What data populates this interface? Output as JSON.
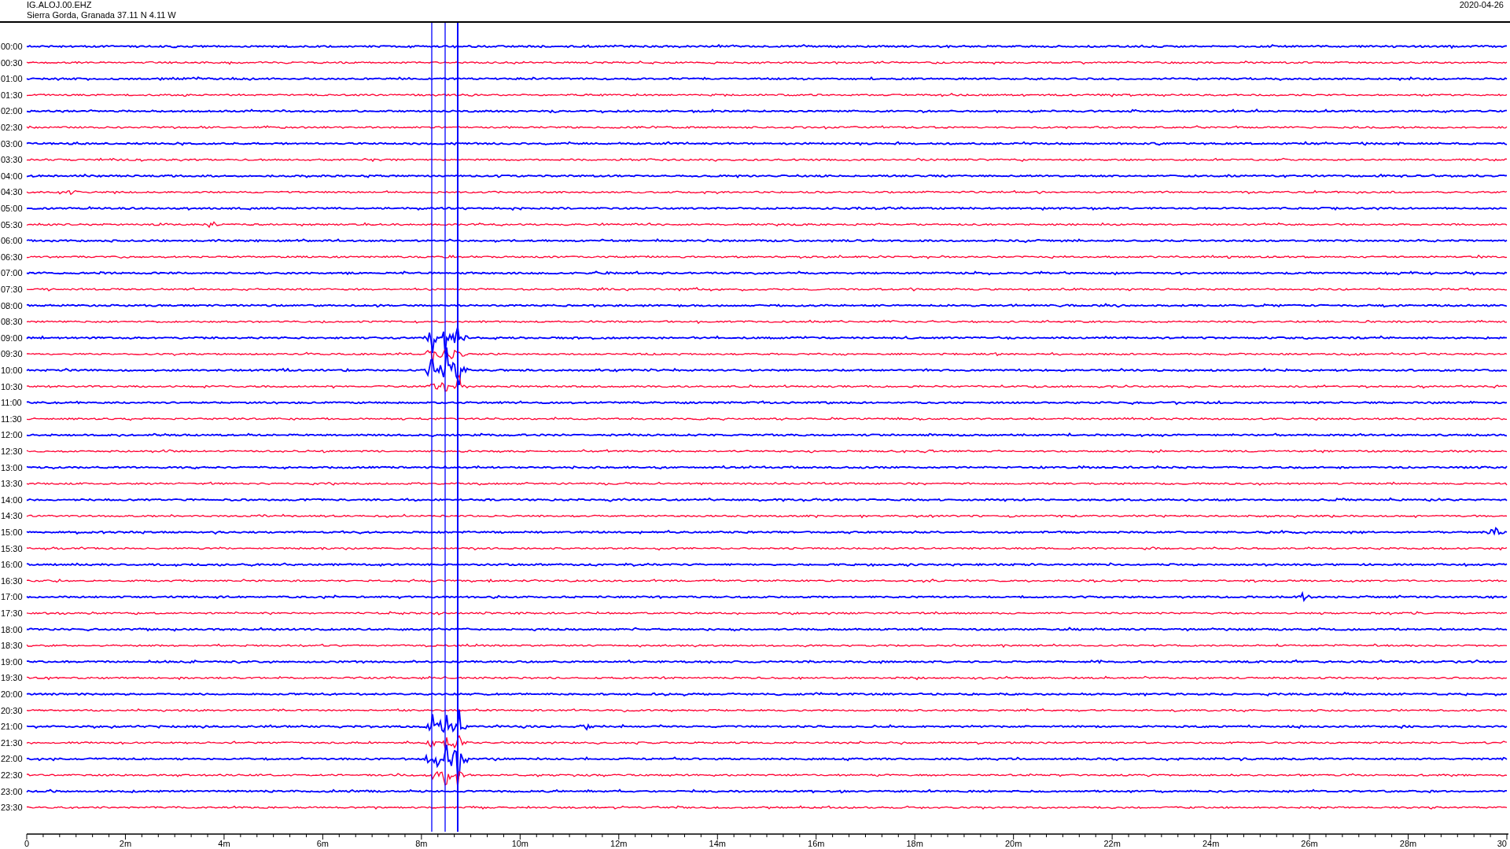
{
  "header": {
    "station": "IG.ALOJ.00.EHZ",
    "location": "Sierra Gorda, Granada  37.11 N 4.11 W",
    "date": "2020-04-26"
  },
  "rows": [
    {
      "time": "00:00",
      "color": "#0000ff"
    },
    {
      "time": "00:30",
      "color": "#ff0033"
    },
    {
      "time": "01:00",
      "color": "#0000ff"
    },
    {
      "time": "01:30",
      "color": "#ff0033"
    },
    {
      "time": "02:00",
      "color": "#0000ff"
    },
    {
      "time": "02:30",
      "color": "#ff0033"
    },
    {
      "time": "03:00",
      "color": "#0000ff"
    },
    {
      "time": "03:30",
      "color": "#ff0033"
    },
    {
      "time": "04:00",
      "color": "#0000ff"
    },
    {
      "time": "04:30",
      "color": "#ff0033"
    },
    {
      "time": "05:00",
      "color": "#0000ff"
    },
    {
      "time": "05:30",
      "color": "#ff0033"
    },
    {
      "time": "06:00",
      "color": "#0000ff"
    },
    {
      "time": "06:30",
      "color": "#ff0033"
    },
    {
      "time": "07:00",
      "color": "#0000ff"
    },
    {
      "time": "07:30",
      "color": "#ff0033"
    },
    {
      "time": "08:00",
      "color": "#0000ff"
    },
    {
      "time": "08:30",
      "color": "#ff0033"
    },
    {
      "time": "09:00",
      "color": "#0000ff"
    },
    {
      "time": "09:30",
      "color": "#ff0033"
    },
    {
      "time": "10:00",
      "color": "#0000ff"
    },
    {
      "time": "10:30",
      "color": "#ff0033"
    },
    {
      "time": "11:00",
      "color": "#0000ff"
    },
    {
      "time": "11:30",
      "color": "#ff0033"
    },
    {
      "time": "12:00",
      "color": "#0000ff"
    },
    {
      "time": "12:30",
      "color": "#ff0033"
    },
    {
      "time": "13:00",
      "color": "#0000ff"
    },
    {
      "time": "13:30",
      "color": "#ff0033"
    },
    {
      "time": "14:00",
      "color": "#0000ff"
    },
    {
      "time": "14:30",
      "color": "#ff0033"
    },
    {
      "time": "15:00",
      "color": "#0000ff"
    },
    {
      "time": "15:30",
      "color": "#ff0033"
    },
    {
      "time": "16:00",
      "color": "#0000ff"
    },
    {
      "time": "16:30",
      "color": "#ff0033"
    },
    {
      "time": "17:00",
      "color": "#0000ff"
    },
    {
      "time": "17:30",
      "color": "#ff0033"
    },
    {
      "time": "18:00",
      "color": "#0000ff"
    },
    {
      "time": "18:30",
      "color": "#ff0033"
    },
    {
      "time": "19:00",
      "color": "#0000ff"
    },
    {
      "time": "19:30",
      "color": "#ff0033"
    },
    {
      "time": "20:00",
      "color": "#0000ff"
    },
    {
      "time": "20:30",
      "color": "#ff0033"
    },
    {
      "time": "21:00",
      "color": "#0000ff"
    },
    {
      "time": "21:30",
      "color": "#ff0033"
    },
    {
      "time": "22:00",
      "color": "#0000ff"
    },
    {
      "time": "22:30",
      "color": "#ff0033"
    },
    {
      "time": "23:00",
      "color": "#0000ff"
    },
    {
      "time": "23:30",
      "color": "#ff0033"
    }
  ],
  "x_axis": {
    "ticks": [
      "0",
      "2m",
      "4m",
      "6m",
      "8m",
      "10m",
      "12m",
      "14m",
      "16m",
      "18m",
      "20m",
      "22m",
      "24m",
      "26m",
      "28m",
      "30"
    ]
  }
}
